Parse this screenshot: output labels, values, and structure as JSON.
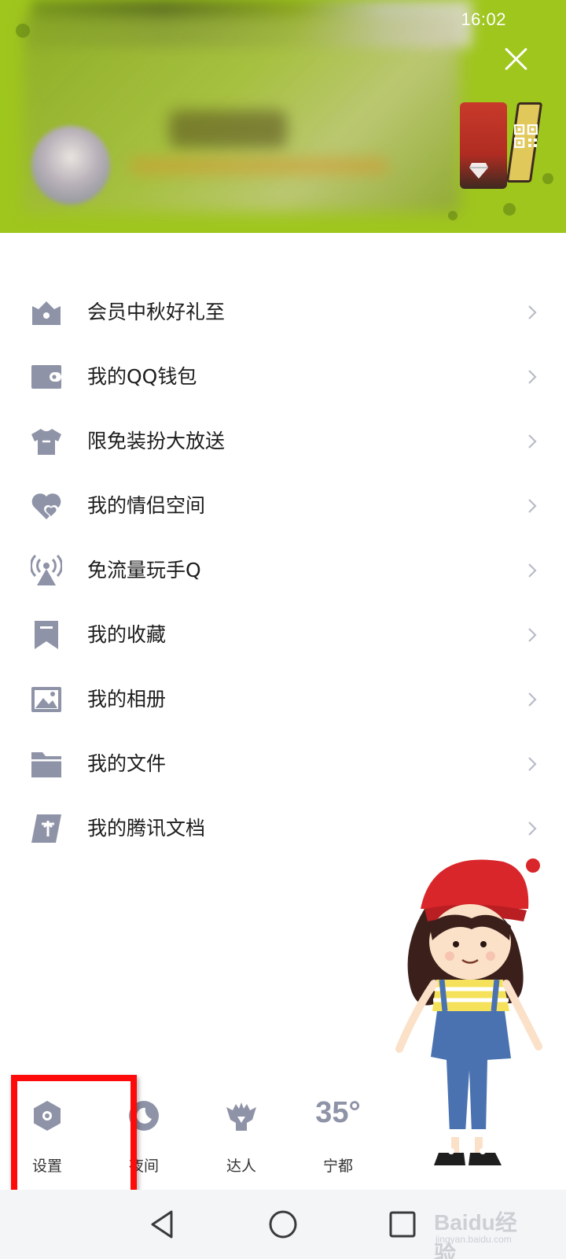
{
  "status_bar": {
    "time": "16:02"
  },
  "header": {
    "close_icon": "close-icon",
    "qr_icon": "qr-code-icon",
    "diamond_icon": "diamond-level-icon",
    "background_color": "#9fc61d"
  },
  "menu": {
    "items": [
      {
        "label": "会员中秋好礼至",
        "icon": "vip-gift-icon"
      },
      {
        "label": "我的QQ钱包",
        "icon": "wallet-icon"
      },
      {
        "label": "限免装扮大放送",
        "icon": "tshirt-icon"
      },
      {
        "label": "我的情侣空间",
        "icon": "heart-icon"
      },
      {
        "label": "免流量玩手Q",
        "icon": "antenna-icon"
      },
      {
        "label": "我的收藏",
        "icon": "bookmark-icon"
      },
      {
        "label": "我的相册",
        "icon": "photo-icon"
      },
      {
        "label": "我的文件",
        "icon": "folder-icon"
      },
      {
        "label": "我的腾讯文档",
        "icon": "tencent-doc-icon"
      }
    ],
    "icon_color": "#8f93a7"
  },
  "bottom_bar": {
    "settings_label": "设置",
    "night_label": "夜间",
    "expert_label": "达人",
    "temperature": "35°",
    "city": "宁都"
  },
  "highlight": {
    "color": "#ff0a0a",
    "target": "settings"
  },
  "watermark": {
    "main": "Baidu经验",
    "sub": "jingyan.baidu.com"
  }
}
